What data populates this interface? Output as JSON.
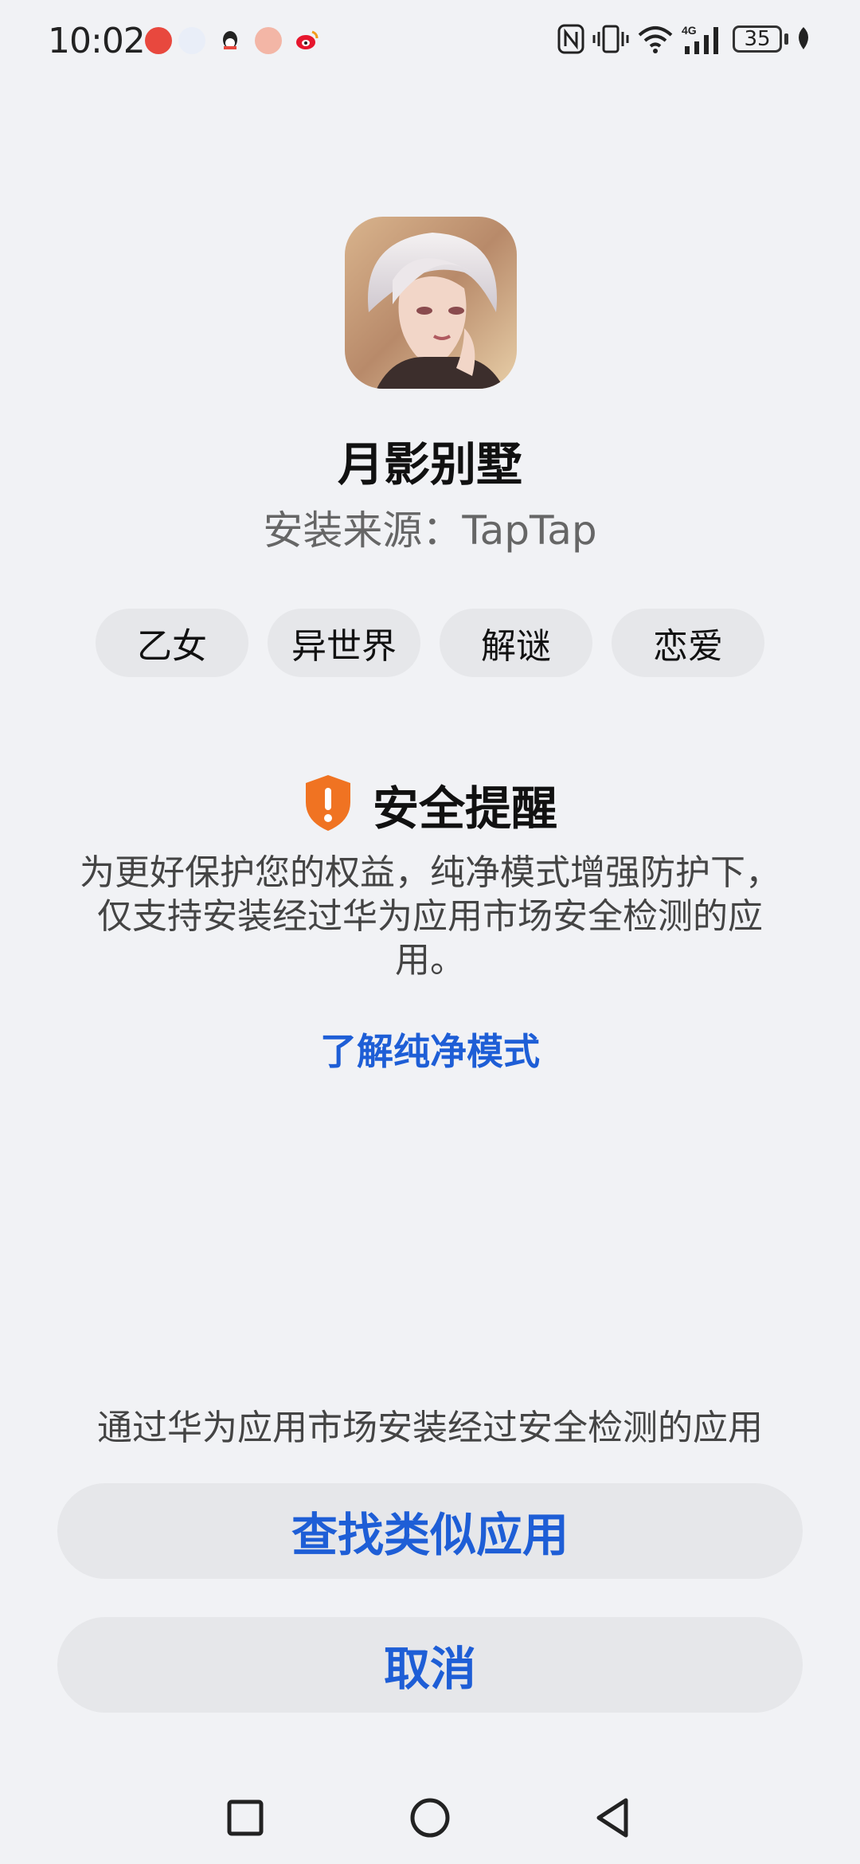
{
  "status_bar": {
    "time": "10:02",
    "battery": "35",
    "network": "4G",
    "notification_icons": [
      "alert-app-icon",
      "app-icon",
      "qq-icon",
      "app-icon",
      "weibo-icon"
    ],
    "system_icons": [
      "nfc-icon",
      "vibrate-icon",
      "wifi-icon",
      "signal-icon",
      "battery-icon",
      "leaf-icon"
    ]
  },
  "app": {
    "name": "月影别墅",
    "source": "安装来源：TapTap"
  },
  "tags": [
    "乙女",
    "异世界",
    "解谜",
    "恋爱"
  ],
  "warning": {
    "title": "安全提醒",
    "body": "为更好保护您的权益，纯净模式增强防护下，仅支持安装经过华为应用市场安全检测的应用。",
    "link": "了解纯净模式",
    "icon": "shield-alert-icon",
    "color": "#f07322"
  },
  "footer": {
    "hint": "通过华为应用市场安装经过安全检测的应用",
    "find_button": "查找类似应用",
    "cancel_button": "取消"
  },
  "colors": {
    "accent": "#1e5ed6",
    "background": "#f1f2f5",
    "chip": "#e6e7ea"
  },
  "nav": [
    "recents-icon",
    "home-icon",
    "back-icon"
  ]
}
